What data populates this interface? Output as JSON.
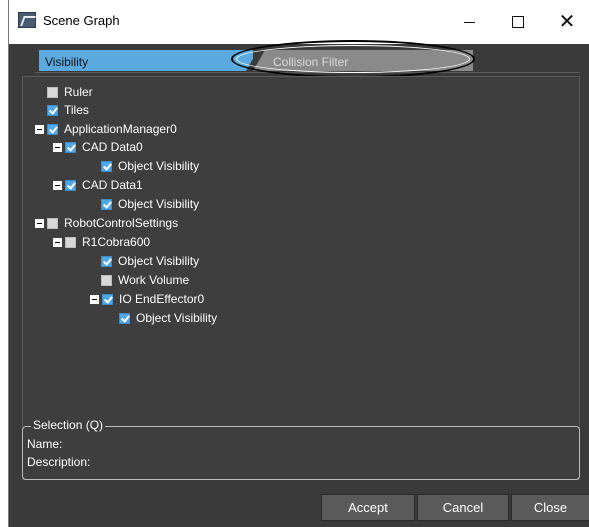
{
  "window": {
    "title": "Scene Graph",
    "controls": {
      "minimize": "—",
      "maximize": "☐",
      "close": "✕"
    }
  },
  "tabs": [
    {
      "label": "Visibility",
      "active": true
    },
    {
      "label": "Collision Filter",
      "active": false
    }
  ],
  "tree": [
    {
      "label": "Ruler",
      "checked": false,
      "expander": false
    },
    {
      "label": "Tiles",
      "checked": true,
      "expander": false
    },
    {
      "label": "ApplicationManager0",
      "checked": true,
      "expander": true
    },
    {
      "label": "CAD Data0",
      "checked": true,
      "expander": true
    },
    {
      "label": "Object Visibility",
      "checked": true,
      "expander": false
    },
    {
      "label": "CAD Data1",
      "checked": true,
      "expander": true
    },
    {
      "label": "Object Visibility",
      "checked": true,
      "expander": false
    },
    {
      "label": "RobotControlSettings",
      "checked": false,
      "expander": true
    },
    {
      "label": "R1Cobra600",
      "checked": false,
      "expander": true
    },
    {
      "label": "Object Visibility",
      "checked": true,
      "expander": false
    },
    {
      "label": "Work Volume",
      "checked": false,
      "expander": false
    },
    {
      "label": "IO EndEffector0",
      "checked": true,
      "expander": true
    },
    {
      "label": "Object Visibility",
      "checked": true,
      "expander": false
    }
  ],
  "selection": {
    "title": "Selection (Q)",
    "name_label": "Name:",
    "description_label": "Description:"
  },
  "buttons": {
    "accept": "Accept",
    "cancel": "Cancel",
    "close": "Close"
  },
  "colors": {
    "accent": "#5aaae0",
    "checkbox": "#4fa8e8",
    "background": "#3a3a3a"
  }
}
